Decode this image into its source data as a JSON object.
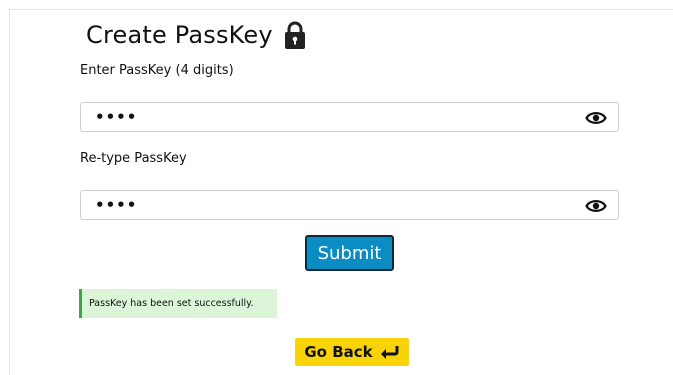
{
  "header": {
    "title": "Create PassKey",
    "title_icon": "lock-icon"
  },
  "form": {
    "passkey_label": "Enter PassKey (4 digits)",
    "passkey_value": "••••",
    "retype_label": "Re-type PassKey",
    "retype_value": "••••",
    "toggle_icon": "eye-icon",
    "submit_label": "Submit"
  },
  "status": {
    "message": "PassKey has been set successfully.",
    "type": "success"
  },
  "footer": {
    "go_back_label": "Go Back",
    "go_back_icon": "return-arrow-icon"
  },
  "colors": {
    "submit_bg": "#0b8cc2",
    "success_bg": "#dcf5d9",
    "success_border": "#3aa84a",
    "go_back_bg": "#f7d307"
  }
}
